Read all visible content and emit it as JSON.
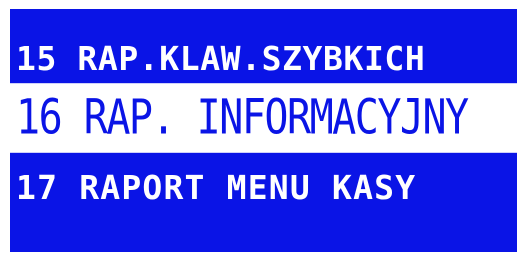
{
  "display": {
    "background_color": "#0a14e6",
    "text_color": "#ffffff",
    "selected_row_background": "#ffffff",
    "selected_row_text_color": "#0a14e6",
    "items": [
      {
        "label": "15 RAP.KLAW.SZYBKICH",
        "selected": false
      },
      {
        "label": "16 RAP. INFORMACYJNY",
        "selected": true
      },
      {
        "label": "17 RAPORT MENU KASY",
        "selected": false
      }
    ]
  }
}
